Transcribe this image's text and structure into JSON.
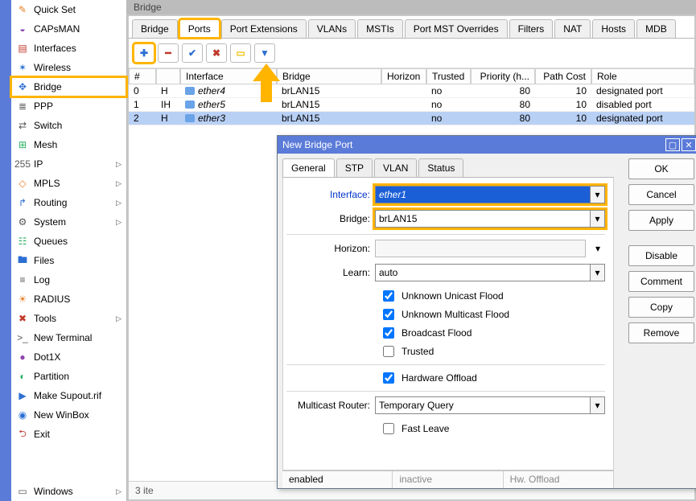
{
  "window": {
    "title": "Bridge"
  },
  "sidebar": {
    "items": [
      {
        "label": "Quick Set",
        "icon": "✎"
      },
      {
        "label": "CAPsMAN",
        "icon": "◒"
      },
      {
        "label": "Interfaces",
        "icon": "▤"
      },
      {
        "label": "Wireless",
        "icon": "✶"
      },
      {
        "label": "Bridge",
        "icon": "✥",
        "selected": true
      },
      {
        "label": "PPP",
        "icon": "≣"
      },
      {
        "label": "Switch",
        "icon": "⇄"
      },
      {
        "label": "Mesh",
        "icon": "⊞"
      },
      {
        "label": "IP",
        "icon": "255",
        "submenu": true
      },
      {
        "label": "MPLS",
        "icon": "◇",
        "submenu": true
      },
      {
        "label": "Routing",
        "icon": "↱",
        "submenu": true
      },
      {
        "label": "System",
        "icon": "⚙",
        "submenu": true
      },
      {
        "label": "Queues",
        "icon": "☷"
      },
      {
        "label": "Files",
        "icon": "🖿"
      },
      {
        "label": "Log",
        "icon": "≡"
      },
      {
        "label": "RADIUS",
        "icon": "☀"
      },
      {
        "label": "Tools",
        "icon": "✖",
        "submenu": true
      },
      {
        "label": "New Terminal",
        "icon": ">_"
      },
      {
        "label": "Dot1X",
        "icon": "●"
      },
      {
        "label": "Partition",
        "icon": "◐"
      },
      {
        "label": "Make Supout.rif",
        "icon": "▶"
      },
      {
        "label": "New WinBox",
        "icon": "◉"
      },
      {
        "label": "Exit",
        "icon": "⮌"
      }
    ],
    "windows_label": "Windows"
  },
  "tabs": [
    "Bridge",
    "Ports",
    "Port Extensions",
    "VLANs",
    "MSTIs",
    "Port MST Overrides",
    "Filters",
    "NAT",
    "Hosts",
    "MDB"
  ],
  "active_tab_index": 1,
  "toolbar": {
    "add": "✚",
    "remove": "━",
    "enable": "✔",
    "disable": "✖",
    "comment": "▭",
    "filter": "▼"
  },
  "grid": {
    "columns": [
      "#",
      "",
      "Interface",
      "Bridge",
      "Horizon",
      "Trusted",
      "Priority (h...",
      "Path Cost",
      "Role"
    ],
    "rows": [
      {
        "n": "0",
        "f": "H",
        "iface": "ether4",
        "bridge": "brLAN15",
        "horizon": "",
        "trusted": "no",
        "priority": "80",
        "cost": "10",
        "role": "designated port",
        "sel": false
      },
      {
        "n": "1",
        "f": "IH",
        "iface": "ether5",
        "bridge": "brLAN15",
        "horizon": "",
        "trusted": "no",
        "priority": "80",
        "cost": "10",
        "role": "disabled port",
        "sel": false
      },
      {
        "n": "2",
        "f": "H",
        "iface": "ether3",
        "bridge": "brLAN15",
        "horizon": "",
        "trusted": "no",
        "priority": "80",
        "cost": "10",
        "role": "designated port",
        "sel": true
      }
    ]
  },
  "status_text": "3 ite",
  "dialog": {
    "title": "New Bridge Port",
    "tabs": [
      "General",
      "STP",
      "VLAN",
      "Status"
    ],
    "buttons": [
      "OK",
      "Cancel",
      "Apply",
      "Disable",
      "Comment",
      "Copy",
      "Remove"
    ],
    "fields": {
      "interface_label": "Interface:",
      "interface_value": "ether1",
      "bridge_label": "Bridge:",
      "bridge_value": "brLAN15",
      "horizon_label": "Horizon:",
      "horizon_value": "",
      "learn_label": "Learn:",
      "learn_value": "auto",
      "unknown_unicast": "Unknown Unicast Flood",
      "unknown_multicast": "Unknown Multicast Flood",
      "broadcast": "Broadcast Flood",
      "trusted": "Trusted",
      "hw_offload": "Hardware Offload",
      "multicast_label": "Multicast Router:",
      "multicast_value": "Temporary Query",
      "fast_leave": "Fast Leave"
    },
    "statusbar": [
      "enabled",
      "inactive",
      "Hw. Offload"
    ]
  }
}
